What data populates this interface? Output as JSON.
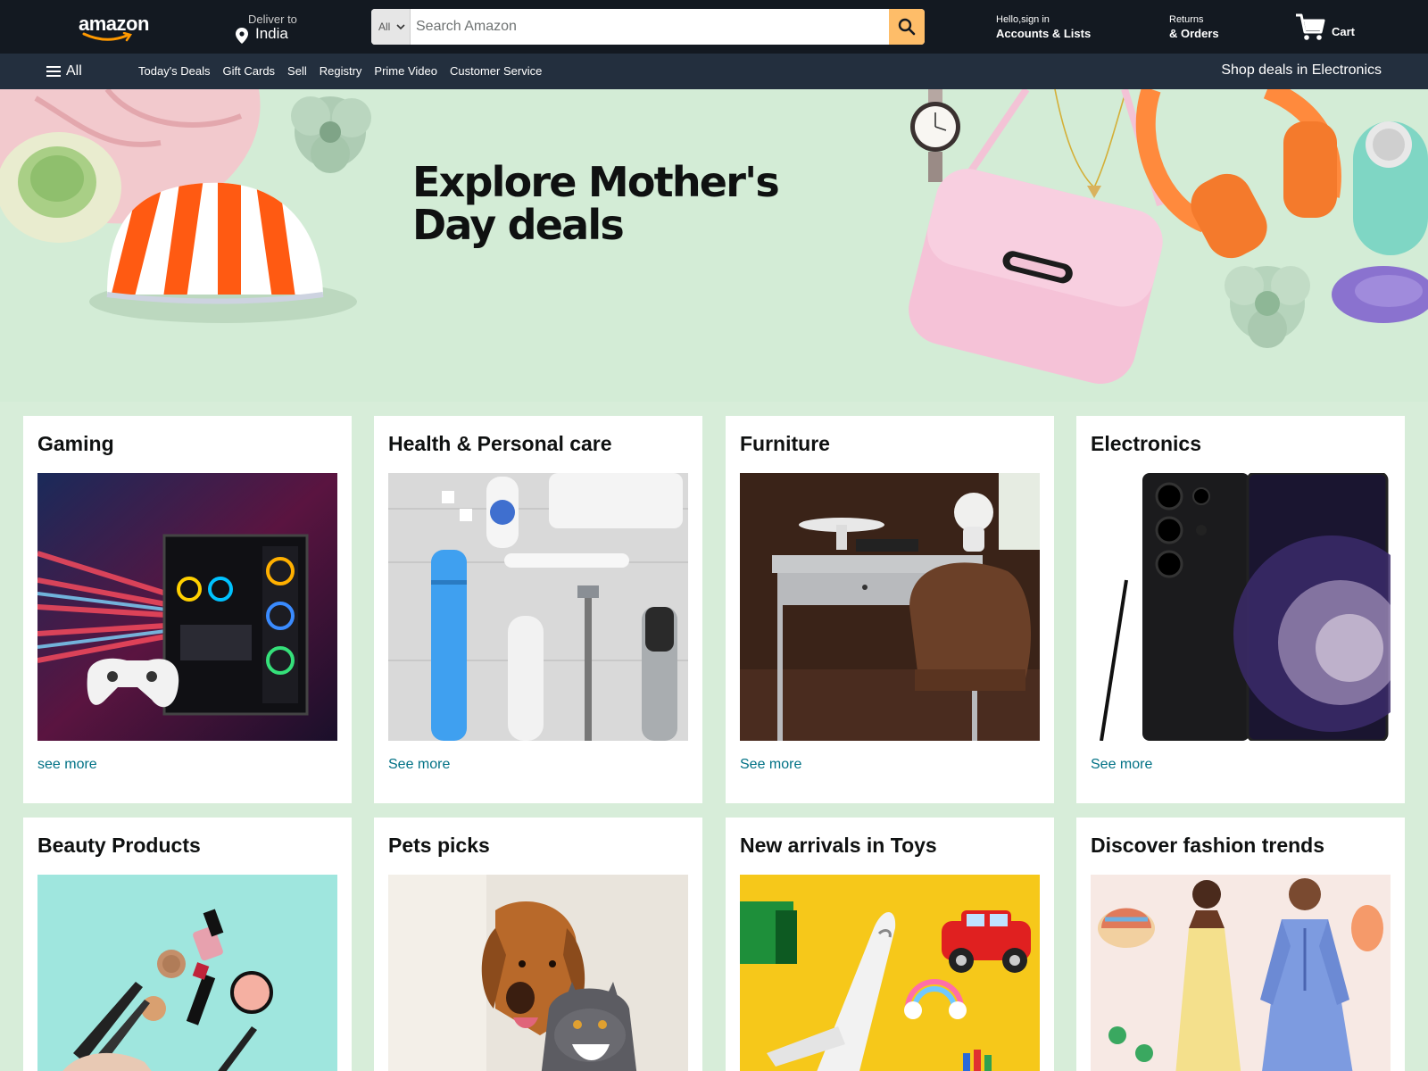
{
  "header": {
    "logo_text": "amazon",
    "deliver_to_label": "Deliver to",
    "deliver_to_location": "India",
    "search": {
      "category": "All",
      "placeholder": "Search Amazon"
    },
    "account_greeting": "Hello,sign in",
    "account_label": "Accounts & Lists",
    "returns_label": "Returns",
    "orders_label": "& Orders",
    "cart_label": "Cart"
  },
  "subnav": {
    "all_label": "All",
    "links": [
      "Today's Deals",
      "Gift Cards",
      "Sell",
      "Registry",
      "Prime Video",
      "Customer Service"
    ],
    "promo": "Shop deals in Electronics"
  },
  "hero": {
    "title": "Explore Mother's Day deals"
  },
  "cards": [
    {
      "title": "Gaming",
      "link": "see more",
      "image": "gaming-pc-and-controller"
    },
    {
      "title": "Health & Personal care",
      "link": "See more",
      "image": "personal-care-products"
    },
    {
      "title": "Furniture",
      "link": "See more",
      "image": "desk-and-chair"
    },
    {
      "title": "Electronics",
      "link": "See more",
      "image": "smartphone-with-stylus"
    },
    {
      "title": "Beauty Products",
      "link": "",
      "image": "makeup-products"
    },
    {
      "title": "Pets picks",
      "link": "",
      "image": "dog-and-cat"
    },
    {
      "title": "New arrivals in Toys",
      "link": "",
      "image": "toy-plane-and-car"
    },
    {
      "title": "Discover fashion trends",
      "link": "",
      "image": "fashion-models"
    }
  ],
  "colors": {
    "topnav": "#131921",
    "subnav": "#232f3e",
    "search_button": "#febd69",
    "page_background": "#d7edd9",
    "link": "#007185"
  }
}
